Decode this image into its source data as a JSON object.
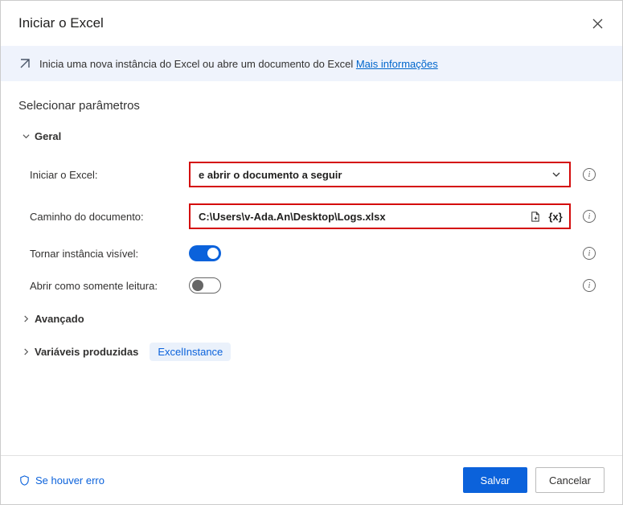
{
  "dialog": {
    "title": "Iniciar o Excel"
  },
  "banner": {
    "text": "Inicia uma nova instância do Excel ou abre um documento do Excel ",
    "link": "Mais informações"
  },
  "section": {
    "heading": "Selecionar parâmetros"
  },
  "groups": {
    "general": "Geral",
    "advanced": "Avançado",
    "variables": "Variáveis produzidas"
  },
  "fields": {
    "launch": {
      "label": "Iniciar o Excel:",
      "value": "e abrir o documento a seguir"
    },
    "path": {
      "label": "Caminho do documento:",
      "value": "C:\\Users\\v-Ada.An\\Desktop\\Logs.xlsx",
      "varToken": "{x}"
    },
    "visible": {
      "label": "Tornar instância visível:"
    },
    "readonly": {
      "label": "Abrir como somente leitura:"
    }
  },
  "variables": {
    "chip": "ExcelInstance"
  },
  "footer": {
    "error": "Se houver erro",
    "save": "Salvar",
    "cancel": "Cancelar"
  }
}
